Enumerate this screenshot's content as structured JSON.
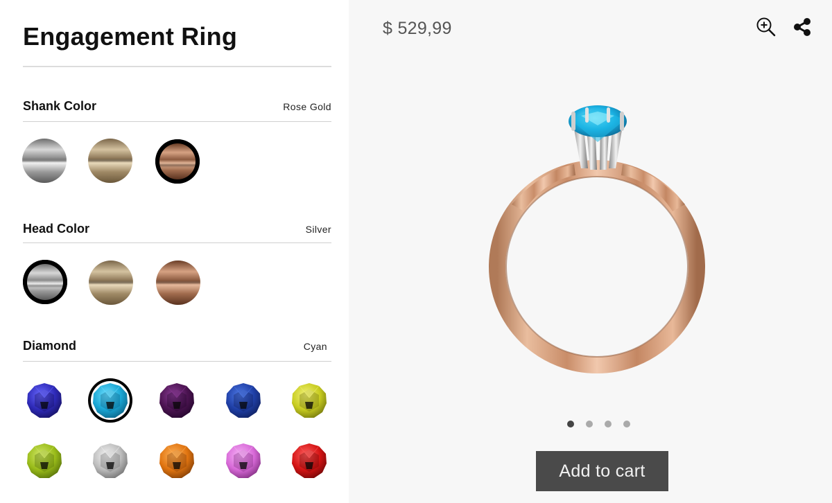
{
  "product": {
    "title": "Engagement Ring",
    "price": "$ 529,99"
  },
  "options": {
    "shank": {
      "label": "Shank Color",
      "selected_value": "Rose Gold",
      "swatches": [
        "silver",
        "yellow-gold",
        "rose-gold"
      ],
      "selected_index": 2
    },
    "head": {
      "label": "Head Color",
      "selected_value": "Silver",
      "swatches": [
        "silver",
        "yellow-gold",
        "rose-gold"
      ],
      "selected_index": 0
    },
    "diamond": {
      "label": "Diamond",
      "selected_value": "Cyan",
      "gems": [
        {
          "name": "violet",
          "color": "#2e2ab8",
          "light": "#6a6aff",
          "dark": "#140f5a"
        },
        {
          "name": "cyan",
          "color": "#1aa6d4",
          "light": "#6fe0ff",
          "dark": "#0a5d80"
        },
        {
          "name": "purple",
          "color": "#4a1350",
          "light": "#8a3b95",
          "dark": "#22062a"
        },
        {
          "name": "blue",
          "color": "#1f3fa6",
          "light": "#4f7ae6",
          "dark": "#0e1e5a"
        },
        {
          "name": "yellow",
          "color": "#c8cc20",
          "light": "#f2f27a",
          "dark": "#6d700c"
        },
        {
          "name": "peridot",
          "color": "#9abc1a",
          "light": "#d2e86a",
          "dark": "#506a08"
        },
        {
          "name": "white",
          "color": "#bdbdbd",
          "light": "#f4f4f4",
          "dark": "#6a6a6a"
        },
        {
          "name": "orange",
          "color": "#e07410",
          "light": "#ffb35a",
          "dark": "#7a3a05"
        },
        {
          "name": "pink",
          "color": "#d86ad8",
          "light": "#f6b2f6",
          "dark": "#7a2a7a"
        },
        {
          "name": "red",
          "color": "#d41414",
          "light": "#ff6060",
          "dark": "#6a0606"
        }
      ],
      "selected_index": 1
    }
  },
  "gallery": {
    "image_count": 4,
    "active_index": 0
  },
  "actions": {
    "add_to_cart": "Add to cart",
    "zoom_icon": "zoom-in-icon",
    "share_icon": "share-icon"
  }
}
